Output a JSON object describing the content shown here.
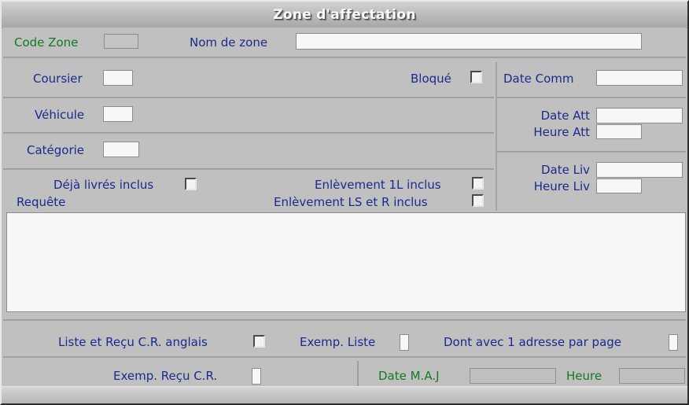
{
  "window": {
    "title": "Zone d'affectation"
  },
  "colors": {
    "label_blue": "#1b2a8c",
    "label_green": "#117a22",
    "window_bg": "#c0c0c0",
    "field_bg": "#f7f7f7",
    "field_readonly_bg": "#c4c4c4",
    "title_text": "#fdfdfd"
  },
  "header": {
    "code_zone": {
      "label": "Code Zone",
      "value": "",
      "placeholder": ""
    },
    "nom_de_zone": {
      "label": "Nom de zone",
      "value": "",
      "placeholder": ""
    }
  },
  "left": {
    "coursier": {
      "label": "Coursier",
      "value": "",
      "placeholder": ""
    },
    "bloque": {
      "label": "Bloqué",
      "checked": false
    },
    "vehicule": {
      "label": "Véhicule",
      "value": "",
      "placeholder": ""
    },
    "categorie": {
      "label": "Catégorie",
      "value": "",
      "placeholder": ""
    },
    "deja_livres_inclus": {
      "label": "Déjà livrés inclus",
      "checked": false
    },
    "enlevement_1l_inclus": {
      "label": "Enlèvement 1L inclus",
      "checked": false
    },
    "enlevement_ls_et_r_inclus": {
      "label": "Enlèvement LS et R inclus",
      "checked": false
    },
    "requete": {
      "label": "Requête",
      "value": "",
      "placeholder": ""
    }
  },
  "right": {
    "date_comm": {
      "label": "Date Comm",
      "value": "",
      "placeholder": ""
    },
    "date_att": {
      "label": "Date Att",
      "value": "",
      "placeholder": ""
    },
    "heure_att": {
      "label": "Heure Att",
      "value": "",
      "placeholder": ""
    },
    "date_liv": {
      "label": "Date Liv",
      "value": "",
      "placeholder": ""
    },
    "heure_liv": {
      "label": "Heure Liv",
      "value": "",
      "placeholder": ""
    }
  },
  "bottom": {
    "liste_recu_anglais": {
      "label": "Liste et Reçu C.R. anglais",
      "checked": false
    },
    "exemp_liste": {
      "label": "Exemp. Liste",
      "value": "",
      "placeholder": ""
    },
    "dont_avec_1_adresse_par_page": {
      "label": "Dont avec 1 adresse par page",
      "value": "",
      "placeholder": ""
    },
    "exemp_recu_cr": {
      "label": "Exemp. Reçu C.R.",
      "value": "",
      "placeholder": ""
    },
    "date_maj": {
      "label": "Date M.A.J",
      "value": "",
      "placeholder": ""
    },
    "heure": {
      "label": "Heure",
      "value": "",
      "placeholder": ""
    }
  }
}
